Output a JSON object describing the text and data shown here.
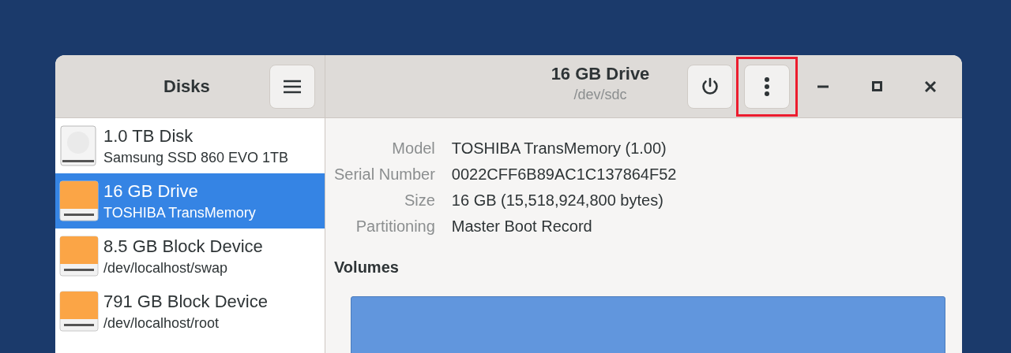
{
  "sidebar": {
    "title": "Disks"
  },
  "header": {
    "title": "16 GB Drive",
    "subtitle": "/dev/sdc",
    "menu_button": {
      "highlighted": true
    }
  },
  "disks": [
    {
      "kind": "hdd",
      "name": "1.0 TB Disk",
      "detail": "Samsung SSD 860 EVO 1TB",
      "selected": false
    },
    {
      "kind": "drive",
      "name": "16 GB Drive",
      "detail": "TOSHIBA TransMemory",
      "selected": true
    },
    {
      "kind": "drive",
      "name": "8.5 GB Block Device",
      "detail": "/dev/localhost/swap",
      "selected": false
    },
    {
      "kind": "drive",
      "name": "791 GB Block Device",
      "detail": "/dev/localhost/root",
      "selected": false
    }
  ],
  "properties": [
    {
      "label": "Model",
      "value": "TOSHIBA TransMemory (1.00)"
    },
    {
      "label": "Serial Number",
      "value": "0022CFF6B89AC1C137864F52"
    },
    {
      "label": "Size",
      "value": "16 GB (15,518,924,800 bytes)"
    },
    {
      "label": "Partitioning",
      "value": "Master Boot Record"
    }
  ],
  "volumes": {
    "title": "Volumes"
  }
}
